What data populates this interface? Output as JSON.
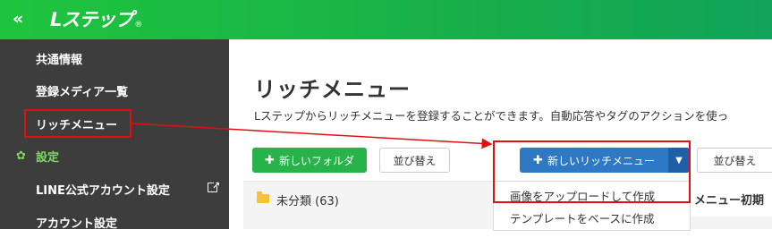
{
  "topbar": {
    "collapse_glyph": "«",
    "logo_text": "Lステップ",
    "logo_mark": "®"
  },
  "sidebar": {
    "items": [
      {
        "label": "共通情報"
      },
      {
        "label": "登録メディア一覧"
      },
      {
        "label": "リッチメニュー"
      },
      {
        "label": "設定"
      },
      {
        "label": "LINE公式アカウント設定"
      },
      {
        "label": "アカウント設定"
      }
    ],
    "icons": {
      "settings": "gear-icon",
      "external": "external-link-icon"
    }
  },
  "main": {
    "title": "リッチメニュー",
    "description": "Lステップからリッチメニューを登録することができます。自動応答やタグのアクションを使っ",
    "buttons": {
      "new_folder": "新しいフォルダ",
      "sort_1": "並び替え",
      "new_rich_menu": "新しいリッチメニュー",
      "sort_2": "並び替え"
    },
    "folder": {
      "label": "未分類 (63)"
    },
    "dropdown": {
      "items": [
        "画像をアップロードして作成",
        "テンプレートをベースに作成"
      ]
    },
    "column_header": "メニュー初期",
    "colors": {
      "green": "#27b24a",
      "blue": "#2f78c4",
      "highlight": "#e01010"
    }
  }
}
